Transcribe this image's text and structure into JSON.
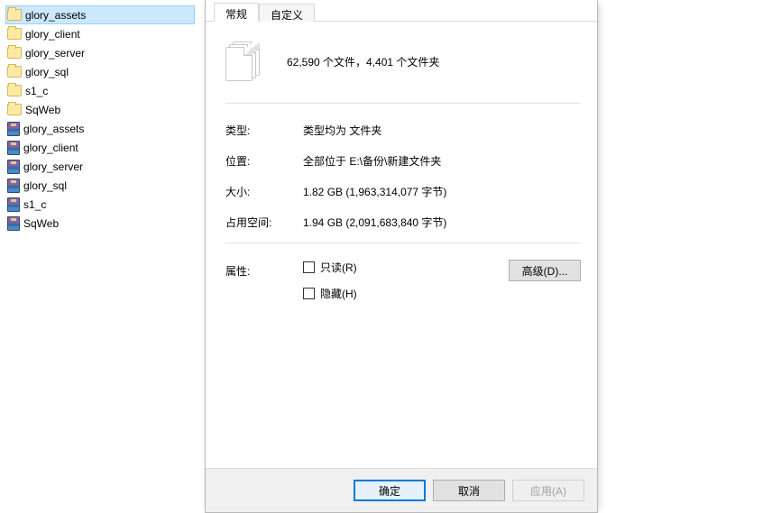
{
  "explorer": {
    "items": [
      {
        "name": "glory_assets",
        "type": "folder",
        "selected": true
      },
      {
        "name": "glory_client",
        "type": "folder"
      },
      {
        "name": "glory_server",
        "type": "folder"
      },
      {
        "name": "glory_sql",
        "type": "folder"
      },
      {
        "name": "s1_c",
        "type": "folder"
      },
      {
        "name": "SqWeb",
        "type": "folder"
      },
      {
        "name": "glory_assets",
        "type": "rar"
      },
      {
        "name": "glory_client",
        "type": "rar"
      },
      {
        "name": "glory_server",
        "type": "rar"
      },
      {
        "name": "glory_sql",
        "type": "rar"
      },
      {
        "name": "s1_c",
        "type": "rar"
      },
      {
        "name": "SqWeb",
        "type": "rar"
      }
    ]
  },
  "dialog": {
    "tabs": {
      "general": "常规",
      "custom": "自定义"
    },
    "summary": "62,590 个文件，4,401 个文件夹",
    "labels": {
      "type": "类型:",
      "location": "位置:",
      "size": "大小:",
      "size_on_disk": "占用空间:",
      "attributes": "属性:"
    },
    "values": {
      "type": "类型均为 文件夹",
      "location": "全部位于 E:\\备份\\新建文件夹",
      "size": "1.82 GB (1,963,314,077 字节)",
      "size_on_disk": "1.94 GB (2,091,683,840 字节)"
    },
    "checkboxes": {
      "readonly": "只读(R)",
      "hidden": "隐藏(H)"
    },
    "advanced_btn": "高级(D)...",
    "buttons": {
      "ok": "确定",
      "cancel": "取消",
      "apply": "应用(A)"
    }
  }
}
